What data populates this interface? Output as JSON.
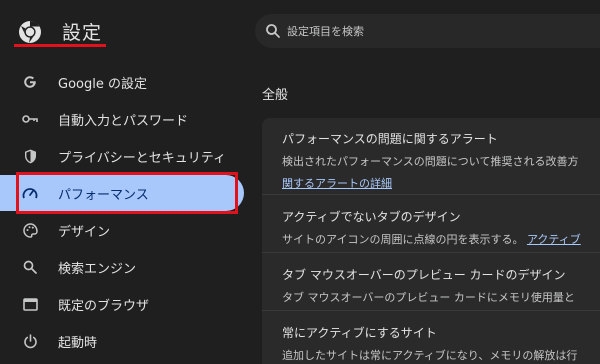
{
  "header": {
    "title": "設定",
    "logo_icon": "chrome-logo-icon",
    "search": {
      "placeholder": "設定項目を検索",
      "icon": "search-icon"
    }
  },
  "sidebar": {
    "items": [
      {
        "label": "Google の設定",
        "icon": "google-g-icon"
      },
      {
        "label": "自動入力とパスワード",
        "icon": "key-icon"
      },
      {
        "label": "プライバシーとセキュリティ",
        "icon": "shield-icon"
      },
      {
        "label": "パフォーマンス",
        "icon": "speedometer-icon",
        "active": true
      },
      {
        "label": "デザイン",
        "icon": "palette-icon"
      },
      {
        "label": "検索エンジン",
        "icon": "search-icon"
      },
      {
        "label": "既定のブラウザ",
        "icon": "browser-window-icon"
      },
      {
        "label": "起動時",
        "icon": "power-icon"
      }
    ]
  },
  "main": {
    "section_title": "全般",
    "settings": [
      {
        "title": "パフォーマンスの問題に関するアラート",
        "description": "検出されたパフォーマンスの問題について推奨される改善方",
        "link": "関するアラートの詳細"
      },
      {
        "title": "アクティブでないタブのデザイン",
        "description": "サイトのアイコンの周囲に点線の円を表示する。",
        "link": "アクティブ"
      },
      {
        "title": "タブ マウスオーバーのプレビュー カードのデザイン",
        "description": "タブ マウスオーバーのプレビュー カードにメモリ使用量と"
      },
      {
        "title": "常にアクティブにするサイト",
        "description": "追加したサイトは常にアクティブになり、メモリの解放は行"
      }
    ]
  },
  "colors": {
    "background": "#1f1f1f",
    "card": "#2a2a2a",
    "active_nav": "#a8c7fa",
    "link": "#a8c7fa",
    "annotation_red": "#e0121b"
  }
}
